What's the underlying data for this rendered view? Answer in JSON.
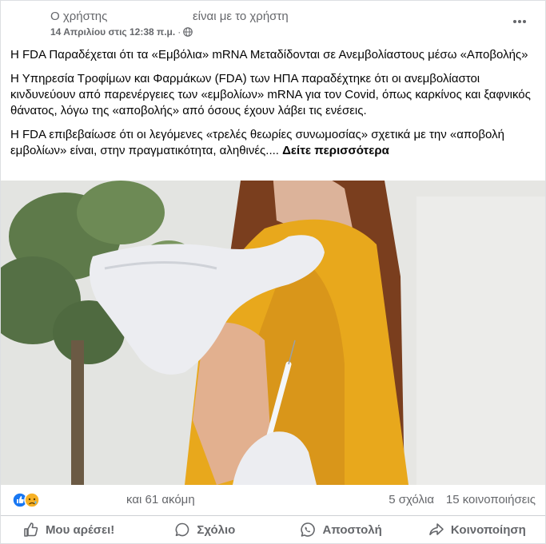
{
  "post": {
    "author": "Ο χρήστης",
    "with_text": "είναι με το χρήστη",
    "date": "14 Απριλίου στις 12:38 π.μ.",
    "separator": "·",
    "paragraphs": [
      "Η FDA Παραδέχεται ότι τα «Εμβόλια» mRNA Μεταδίδονται σε Ανεμβολίαστους μέσω «Αποβολής»",
      "Η Υπηρεσία Τροφίμων και Φαρμάκων (FDA) των ΗΠΑ παραδέχτηκε ότι οι ανεμβολίαστοι κινδυνεύουν από παρενέργειες των «εμβολίων» mRNA για τον Covid, όπως καρκίνος και ξαφνικός θάνατος, λόγω της «αποβολής» από όσους έχουν λάβει τις ενέσεις."
    ],
    "last_paragraph": "Η FDA επιβεβαίωσε ότι οι λεγόμενες «τρελές θεωρίες συνωμοσίας» σχετικά με την «αποβολή εμβολίων» είναι, στην πραγματικότητα, αληθινές....",
    "see_more": "Δείτε περισσότερα"
  },
  "reactions": {
    "count_text": "και 61 ακόμη",
    "comments": "5 σχόλια",
    "shares": "15 κοινοποιήσεις",
    "icons": [
      "like-icon",
      "sad-icon"
    ]
  },
  "actions": {
    "like": "Μου αρέσει!",
    "comment": "Σχόλιο",
    "send": "Αποστολή",
    "share": "Κοινοποίηση"
  },
  "colors": {
    "text": "#050505",
    "secondary": "#65676b",
    "like_blue": "#1877f2",
    "sad_yellow": "#f7b125",
    "shirt": "#e8a81c"
  }
}
